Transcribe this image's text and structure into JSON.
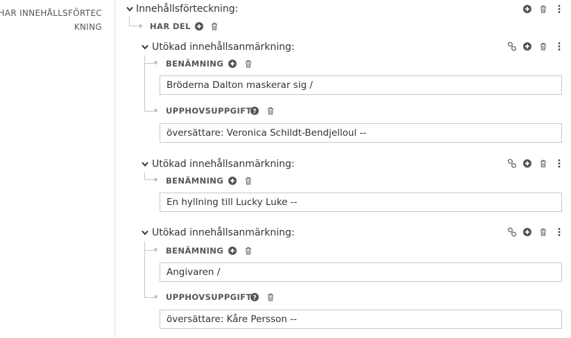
{
  "left_label": "HAR INNEHÅLLSFÖRTECKNING",
  "root": {
    "heading": "Innehållsförteckning:",
    "har_del_label": "HAR DEL"
  },
  "groups": [
    {
      "heading": "Utökad innehållsanmärkning:",
      "fields": [
        {
          "label": "BENÄMNING",
          "value": "Bröderna Dalton maskerar sig /"
        },
        {
          "label": "UPPHOVSUPPGIFT",
          "value": "översättare: Veronica Schildt-Bendjelloul --"
        }
      ]
    },
    {
      "heading": "Utökad innehållsanmärkning:",
      "fields": [
        {
          "label": "BENÄMNING",
          "value": "En hyllning till Lucky Luke --"
        }
      ]
    },
    {
      "heading": "Utökad innehållsanmärkning:",
      "fields": [
        {
          "label": "BENÄMNING",
          "value": "Angivaren /"
        },
        {
          "label": "UPPHOVSUPPGIFT",
          "value": "översättare: Kåre Persson --"
        }
      ]
    }
  ],
  "icons": {
    "add": "plus-circle-icon",
    "delete": "trash-icon",
    "more": "more-vertical-icon",
    "link": "link-icon",
    "help": "question-circle-icon",
    "collapse": "chevron-down-icon"
  },
  "colors": {
    "icon": "#555555",
    "tree_line": "#c5c5c5",
    "field_border": "#c8c8c8"
  }
}
